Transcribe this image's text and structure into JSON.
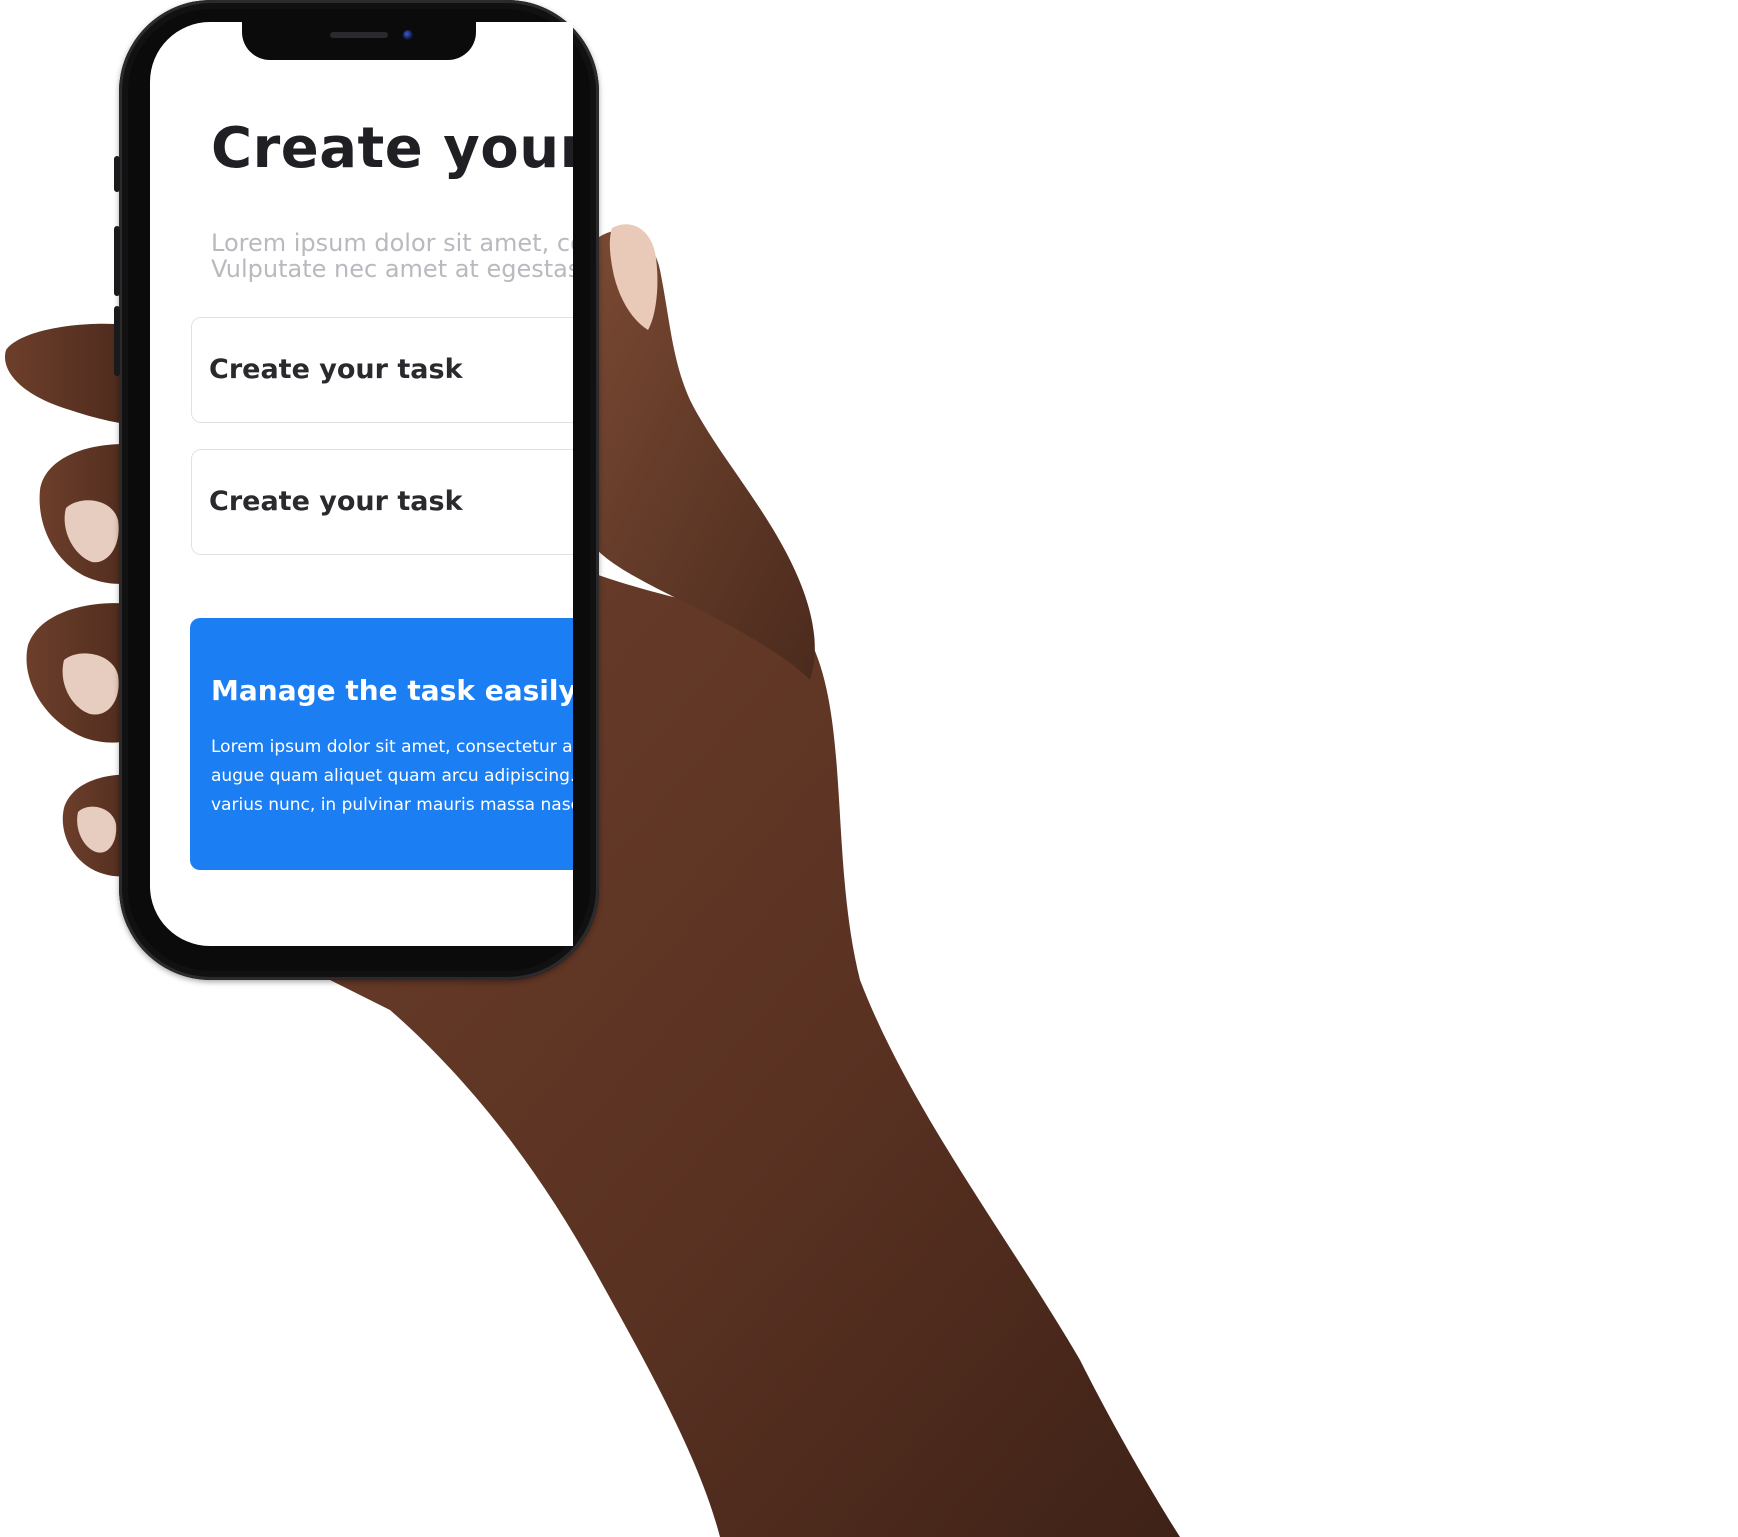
{
  "screen": {
    "title": "Create your t",
    "subtitle_lines": [
      "Lorem ipsum dolor sit amet, co",
      "Vulputate nec amet at egestas"
    ],
    "task_cards": [
      {
        "label": "Create your task"
      },
      {
        "label": "Create your task"
      }
    ],
    "promo": {
      "title": "Manage the task easily and",
      "body_lines": [
        "Lorem ipsum dolor sit amet, consectetur adi",
        "augue quam aliquet quam arcu adipiscing. E",
        "varius nunc, in pulvinar mauris massa nascet"
      ]
    }
  },
  "colors": {
    "accent": "#1b7ef2",
    "title_text": "#1f1f24",
    "subtitle_text": "#b9b9bf",
    "card_border": "#e2e2e6",
    "phone_body": "#0b0b0c",
    "skin": "#5a3424"
  },
  "icons": {
    "camera": "front-camera-icon",
    "speaker": "earpiece-speaker-icon"
  }
}
